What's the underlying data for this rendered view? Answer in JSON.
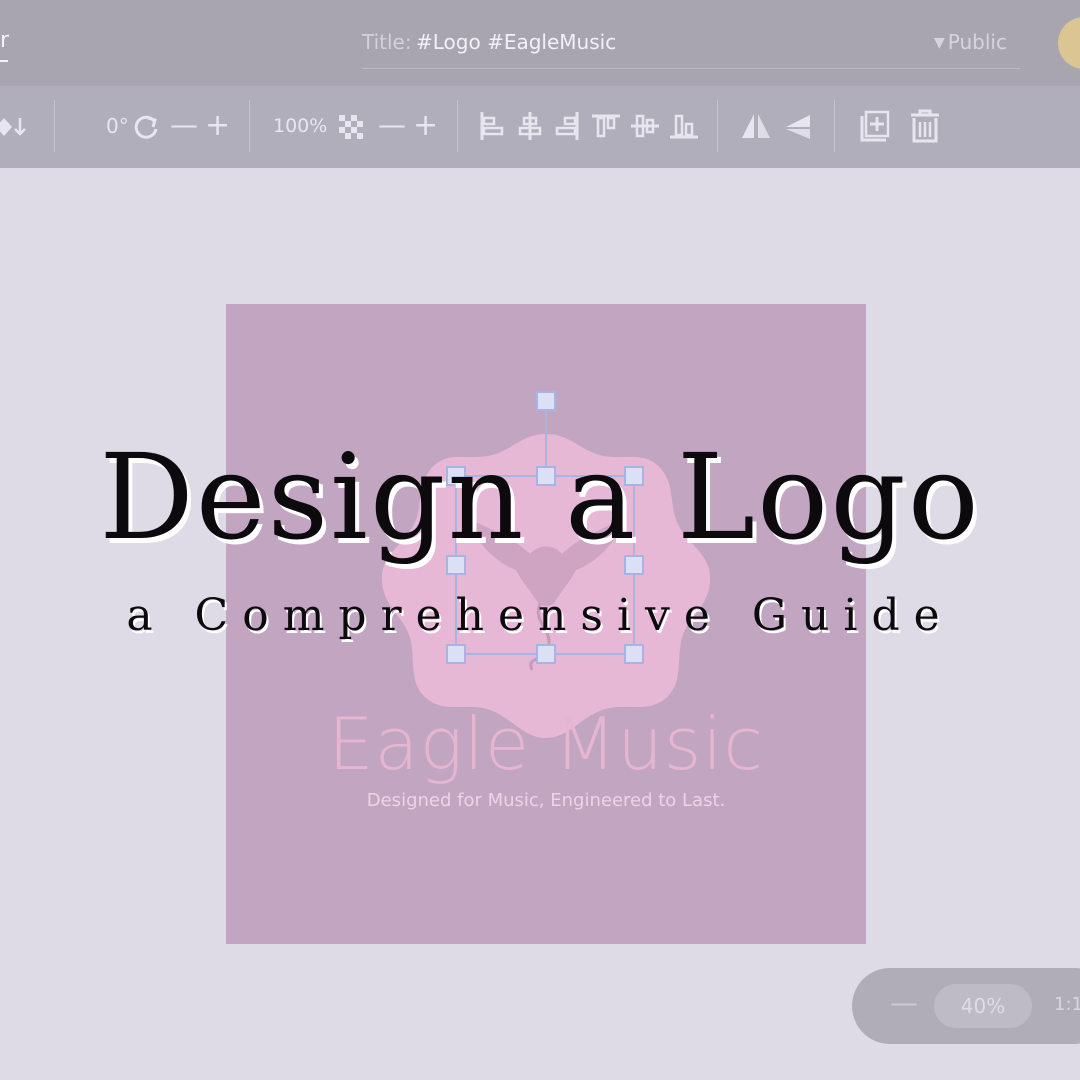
{
  "header": {
    "left_fragment": "r",
    "title_label": "Title:",
    "title_value": "#Logo #EagleMusic",
    "visibility": "Public"
  },
  "toolbar": {
    "rotation": "0°",
    "opacity": "100%"
  },
  "artboard": {
    "brand_name": "Eagle Music",
    "tagline": "Designed for Music, Engineered to Last."
  },
  "overlay": {
    "headline": "Design a Logo",
    "subheadline": "a Comprehensive Guide"
  },
  "zoom": {
    "minus": "—",
    "level": "40%",
    "ratio": "1:1"
  },
  "colors": {
    "artboard": "#c2a6c1",
    "badge": "#e6b8d6",
    "handles": "#dce0f5"
  }
}
